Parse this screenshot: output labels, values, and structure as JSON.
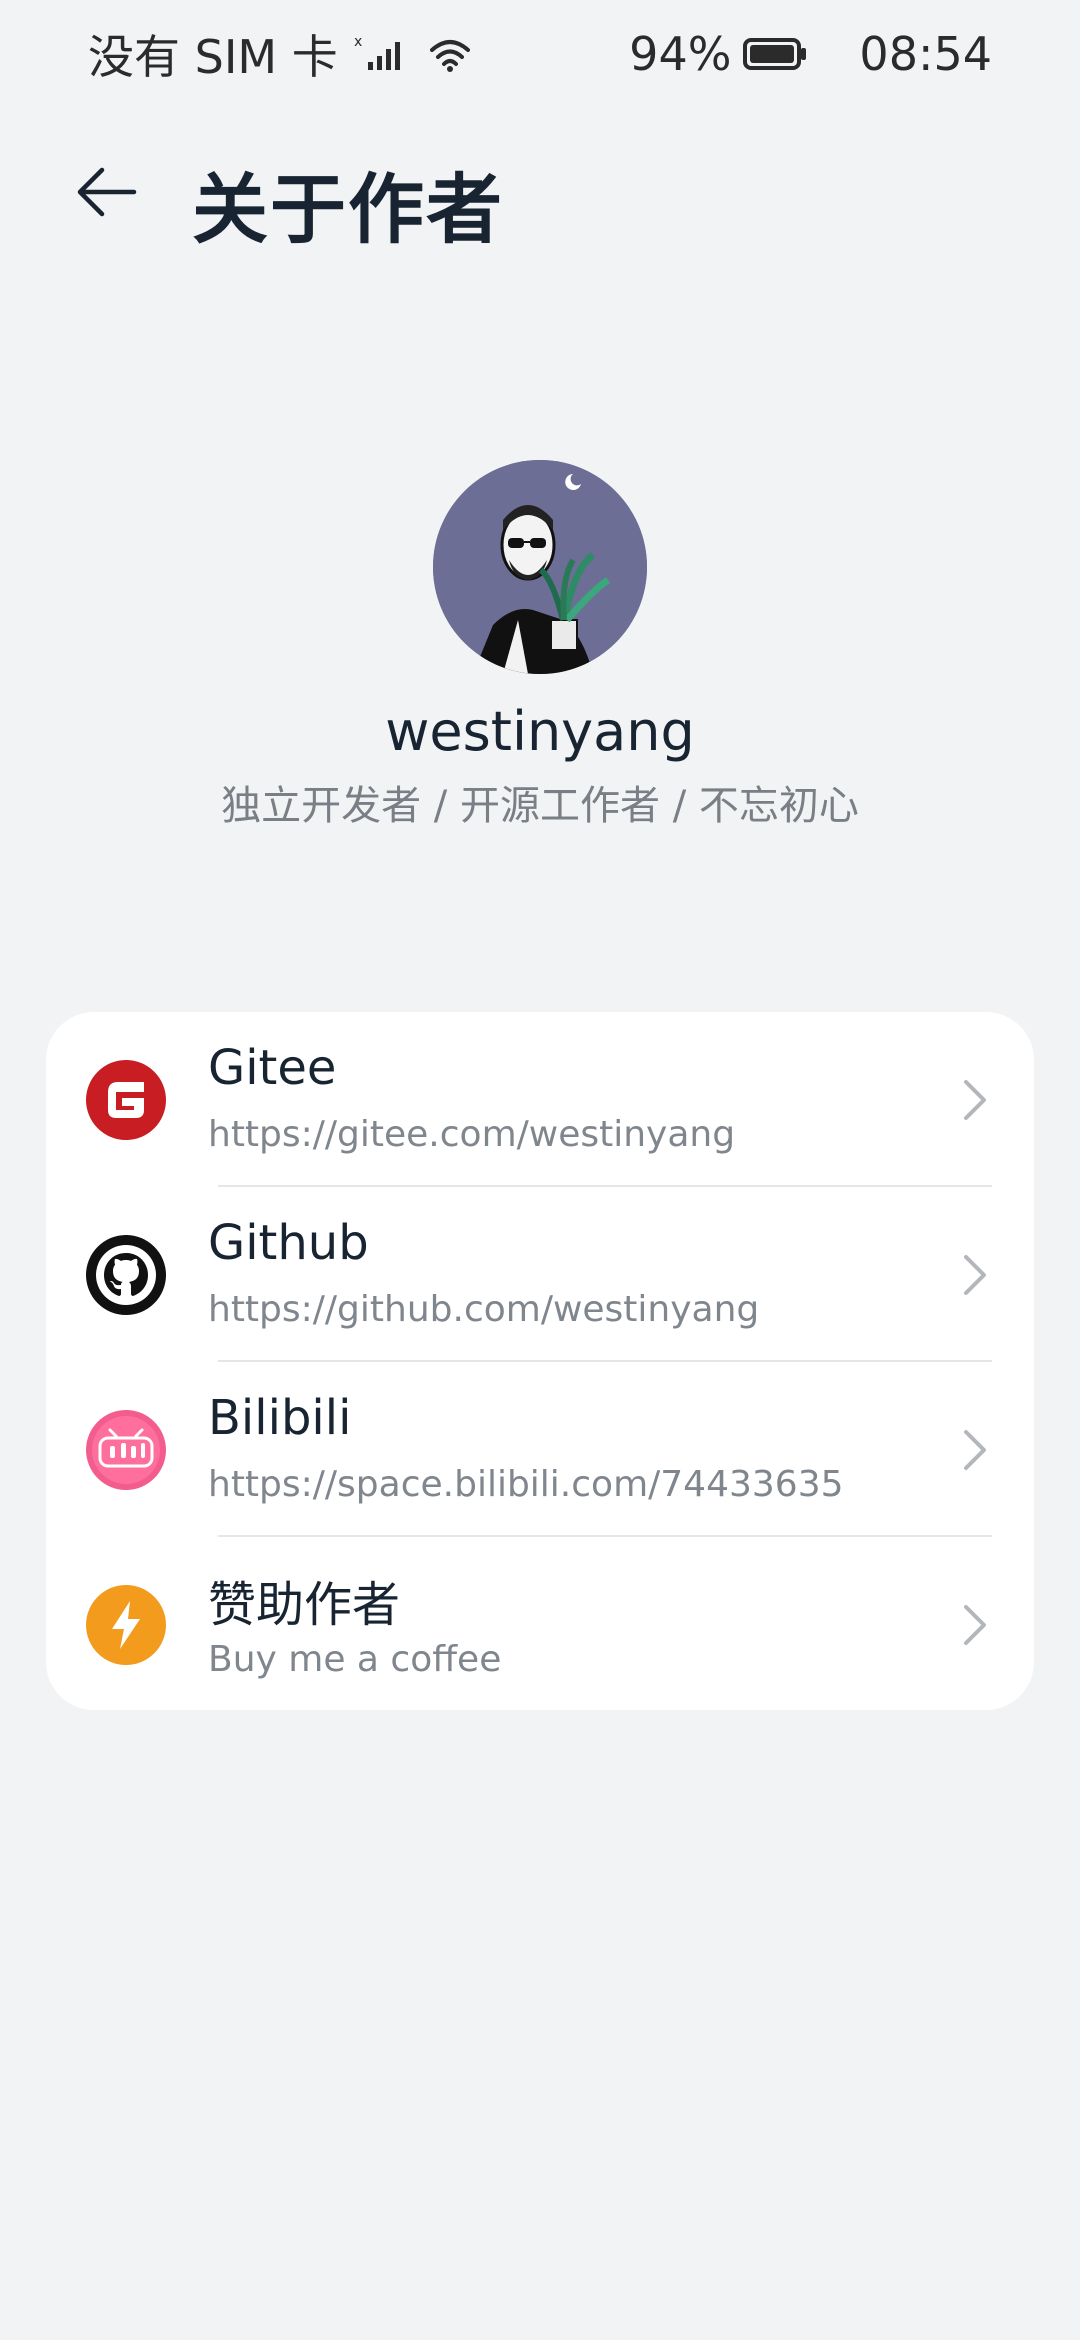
{
  "status": {
    "carrier": "没有 SIM 卡",
    "battery": "94%",
    "time": "08:54"
  },
  "header": {
    "title": "关于作者"
  },
  "profile": {
    "name": "westinyang",
    "bio": "独立开发者 / 开源工作者 / 不忘初心"
  },
  "links": [
    {
      "label": "Gitee",
      "sub": "https://gitee.com/westinyang",
      "icon": "gitee-icon",
      "color": "#c71d23"
    },
    {
      "label": "Github",
      "sub": "https://github.com/westinyang",
      "icon": "github-icon",
      "color": "#1b1b1b"
    },
    {
      "label": "Bilibili",
      "sub": "https://space.bilibili.com/74433635",
      "icon": "bilibili-icon",
      "color": "#f25d8e"
    },
    {
      "label": "赞助作者",
      "sub": "Buy me a coffee",
      "icon": "sponsor-icon",
      "color": "#f29b1d"
    }
  ],
  "colors": {
    "background": "#f1f3f5",
    "card": "#ffffff",
    "primary_text": "#182431",
    "secondary_text": "#80868d"
  }
}
